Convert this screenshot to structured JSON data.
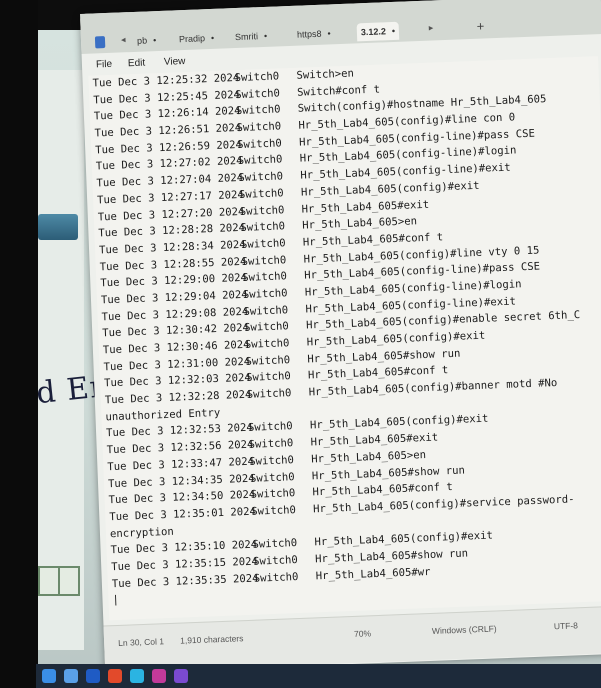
{
  "tabs": [
    {
      "label": "pb"
    },
    {
      "label": "Pradip"
    },
    {
      "label": "Smriti"
    },
    {
      "label": "https8"
    },
    {
      "label": "3.12.2",
      "active": true
    }
  ],
  "menu": [
    "File",
    "Edit",
    "View"
  ],
  "log": [
    {
      "ts": "Tue Dec 3 12:25:32 2024",
      "dev": "Switch0",
      "cmd": "Switch>en"
    },
    {
      "ts": "Tue Dec 3 12:25:45 2024",
      "dev": "Switch0",
      "cmd": "Switch#conf t"
    },
    {
      "ts": "Tue Dec 3 12:26:14 2024",
      "dev": "Switch0",
      "cmd": "Switch(config)#hostname Hr_5th_Lab4_605"
    },
    {
      "ts": "Tue Dec 3 12:26:51 2024",
      "dev": "Switch0",
      "cmd": "Hr_5th_Lab4_605(config)#line con 0"
    },
    {
      "ts": "Tue Dec 3 12:26:59 2024",
      "dev": "Switch0",
      "cmd": "Hr_5th_Lab4_605(config-line)#pass CSE"
    },
    {
      "ts": "Tue Dec 3 12:27:02 2024",
      "dev": "Switch0",
      "cmd": "Hr_5th_Lab4_605(config-line)#login"
    },
    {
      "ts": "Tue Dec 3 12:27:04 2024",
      "dev": "Switch0",
      "cmd": "Hr_5th_Lab4_605(config-line)#exit"
    },
    {
      "ts": "Tue Dec 3 12:27:17 2024",
      "dev": "Switch0",
      "cmd": "Hr_5th_Lab4_605(config)#exit"
    },
    {
      "ts": "Tue Dec 3 12:27:20 2024",
      "dev": "Switch0",
      "cmd": "Hr_5th_Lab4_605#exit"
    },
    {
      "ts": "Tue Dec 3 12:28:28 2024",
      "dev": "Switch0",
      "cmd": "Hr_5th_Lab4_605>en"
    },
    {
      "ts": "Tue Dec 3 12:28:34 2024",
      "dev": "Switch0",
      "cmd": "Hr_5th_Lab4_605#conf t"
    },
    {
      "ts": "Tue Dec 3 12:28:55 2024",
      "dev": "Switch0",
      "cmd": "Hr_5th_Lab4_605(config)#line vty 0 15"
    },
    {
      "ts": "Tue Dec 3 12:29:00 2024",
      "dev": "Switch0",
      "cmd": "Hr_5th_Lab4_605(config-line)#pass CSE"
    },
    {
      "ts": "Tue Dec 3 12:29:04 2024",
      "dev": "Switch0",
      "cmd": "Hr_5th_Lab4_605(config-line)#login"
    },
    {
      "ts": "Tue Dec 3 12:29:08 2024",
      "dev": "Switch0",
      "cmd": "Hr_5th_Lab4_605(config-line)#exit"
    },
    {
      "ts": "Tue Dec 3 12:30:42 2024",
      "dev": "Switch0",
      "cmd": "Hr_5th_Lab4_605(config)#enable secret 6th_C"
    },
    {
      "ts": "Tue Dec 3 12:30:46 2024",
      "dev": "Switch0",
      "cmd": "Hr_5th_Lab4_605(config)#exit"
    },
    {
      "ts": "Tue Dec 3 12:31:00 2024",
      "dev": "Switch0",
      "cmd": "Hr_5th_Lab4_605#show run"
    },
    {
      "ts": "Tue Dec 3 12:32:03 2024",
      "dev": "Switch0",
      "cmd": "Hr_5th_Lab4_605#conf t"
    },
    {
      "ts": "Tue Dec 3 12:32:28 2024",
      "dev": "Switch0",
      "cmd": "Hr_5th_Lab4_605(config)#banner motd #No"
    },
    {
      "wrap": "unauthorized Entry"
    },
    {
      "ts": "Tue Dec 3 12:32:53 2024",
      "dev": "Switch0",
      "cmd": "Hr_5th_Lab4_605(config)#exit"
    },
    {
      "ts": "Tue Dec 3 12:32:56 2024",
      "dev": "Switch0",
      "cmd": "Hr_5th_Lab4_605#exit"
    },
    {
      "ts": "Tue Dec 3 12:33:47 2024",
      "dev": "Switch0",
      "cmd": "Hr_5th_Lab4_605>en"
    },
    {
      "ts": "Tue Dec 3 12:34:35 2024",
      "dev": "Switch0",
      "cmd": "Hr_5th_Lab4_605#show run"
    },
    {
      "ts": "Tue Dec 3 12:34:50 2024",
      "dev": "Switch0",
      "cmd": "Hr_5th_Lab4_605#conf t"
    },
    {
      "ts": "Tue Dec 3 12:35:01 2024",
      "dev": "Switch0",
      "cmd": "Hr_5th_Lab4_605(config)#service password-"
    },
    {
      "wrap": "encryption"
    },
    {
      "ts": "Tue Dec 3 12:35:10 2024",
      "dev": "Switch0",
      "cmd": "Hr_5th_Lab4_605(config)#exit"
    },
    {
      "ts": "Tue Dec 3 12:35:15 2024",
      "dev": "Switch0",
      "cmd": "Hr_5th_Lab4_605#show run"
    },
    {
      "ts": "Tue Dec 3 12:35:35 2024",
      "dev": "Switch0",
      "cmd": "Hr_5th_Lab4_605#wr"
    }
  ],
  "status": {
    "position": "Ln 30, Col 1",
    "chars": "1,910 characters",
    "zoom": "70%",
    "eol": "Windows (CRLF)",
    "encoding": "UTF-8"
  },
  "desktop": {
    "handwriting": "d Entry"
  }
}
